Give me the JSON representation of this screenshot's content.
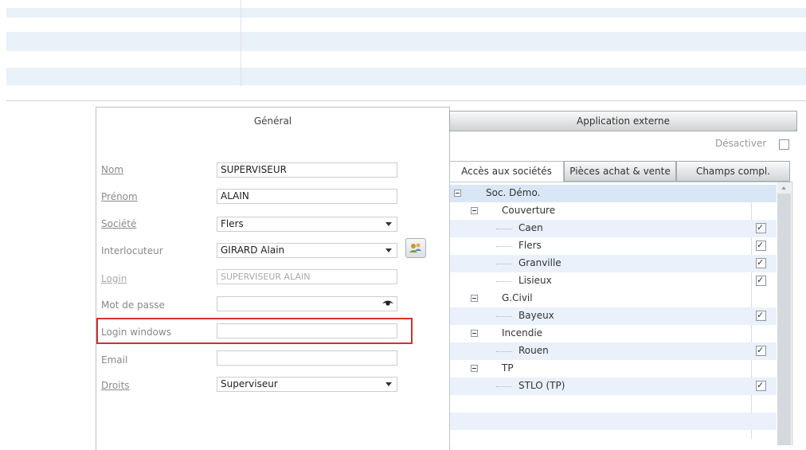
{
  "form": {
    "tab_general": "Général",
    "fields": [
      {
        "label": "Nom",
        "value": "SUPERVISEUR"
      },
      {
        "label": "Prénom",
        "value": "ALAIN"
      },
      {
        "label": "Société",
        "value": "Flers"
      },
      {
        "label": "Interlocuteur",
        "value": "GIRARD Alain"
      },
      {
        "label": "Login",
        "value": "SUPERVISEUR ALAIN"
      },
      {
        "label": "Mot de passe",
        "value": ""
      },
      {
        "label": "Login windows",
        "value": ""
      },
      {
        "label": "Email",
        "value": ""
      },
      {
        "label": "Droits",
        "value": "Superviseur"
      }
    ]
  },
  "right": {
    "tab_app_externe": "Application externe",
    "desactiver_label": "Désactiver",
    "tabs": [
      "Accès aux sociétés",
      "Pièces achat & vente",
      "Champs compl."
    ],
    "tree": [
      {
        "label": "Soc. Démo.",
        "level": 0,
        "toggle": true,
        "checked": null
      },
      {
        "label": "Couverture",
        "level": 1,
        "toggle": true,
        "checked": null
      },
      {
        "label": "Caen",
        "level": 2,
        "toggle": false,
        "checked": true
      },
      {
        "label": "Flers",
        "level": 2,
        "toggle": false,
        "checked": true
      },
      {
        "label": "Granville",
        "level": 2,
        "toggle": false,
        "checked": true
      },
      {
        "label": "Lisieux",
        "level": 2,
        "toggle": false,
        "checked": true
      },
      {
        "label": "G.Civil",
        "level": 1,
        "toggle": true,
        "checked": null
      },
      {
        "label": "Bayeux",
        "level": 2,
        "toggle": false,
        "checked": true
      },
      {
        "label": "Incendie",
        "level": 1,
        "toggle": true,
        "checked": null
      },
      {
        "label": "Rouen",
        "level": 2,
        "toggle": false,
        "checked": true
      },
      {
        "label": "TP",
        "level": 1,
        "toggle": true,
        "checked": null
      },
      {
        "label": "STLO (TP)",
        "level": 2,
        "toggle": false,
        "checked": true
      }
    ]
  },
  "colors": {
    "highlight": "#d03232",
    "row_alt": "#eaf1fa"
  }
}
